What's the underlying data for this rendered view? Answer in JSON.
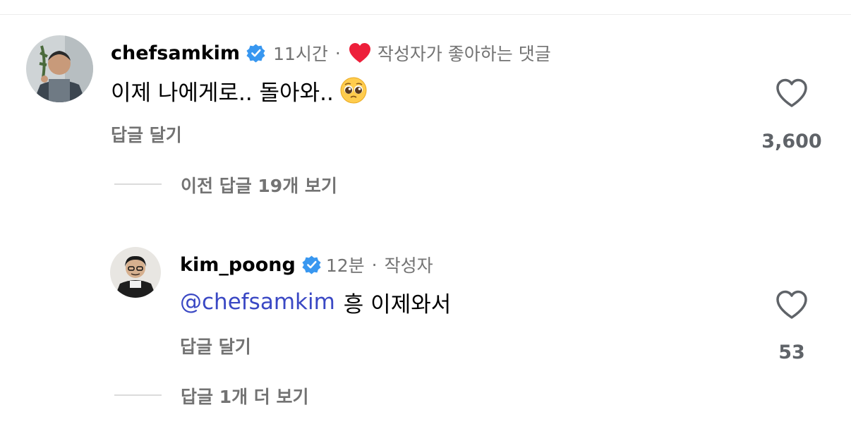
{
  "colors": {
    "accent_blue": "#3897f0",
    "mention": "#3a48c4",
    "like_red": "#ed1f3a",
    "muted": "#737373"
  },
  "comments": [
    {
      "username": "chefsamkim",
      "verified": true,
      "time": "11시간",
      "separator": "·",
      "author_liked_label": "작성자가 좋아하는 댓글",
      "text": "이제 나에게로.. 돌아와..",
      "emoji": "pleading-face",
      "reply_label": "답글 달기",
      "like_count": "3,600"
    }
  ],
  "thread": {
    "view_previous_label": "이전 답글 19개 보기"
  },
  "replies": [
    {
      "username": "kim_poong",
      "verified": true,
      "time": "12분",
      "separator": "·",
      "role_label": "작성자",
      "mention": "@chefsamkim",
      "text": "흥 이제와서",
      "reply_label": "답글 달기",
      "like_count": "53"
    }
  ],
  "more": {
    "view_more_label": "답글 1개 더 보기"
  }
}
